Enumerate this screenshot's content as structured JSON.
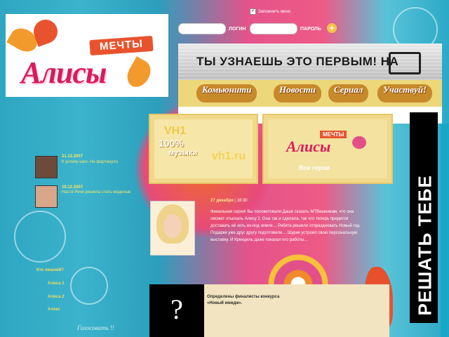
{
  "logo": {
    "badge": "МЕЧТЫ",
    "title": "Алисы"
  },
  "login": {
    "remember_label": "Запомнить меня",
    "login_label": "ЛОГИН",
    "password_label": "ПАРОЛЬ",
    "submit_symbol": "+"
  },
  "banner": {
    "text": "ТЫ УЗНАЕШЬ ЭТО ПЕРВЫМ!  НА"
  },
  "nav": {
    "items": [
      {
        "label": "Комьюнити"
      },
      {
        "label": "Новости"
      },
      {
        "label": "Сериал"
      },
      {
        "label": "Участвуй!"
      }
    ]
  },
  "promos": [
    {
      "line1": "VH1",
      "line2": "100%",
      "line3": "музыки",
      "logo": "vh1.ru"
    },
    {
      "badge": "МЕЧТЫ",
      "title": "Алисы",
      "caption": "Все герои"
    }
  ],
  "side_banner": {
    "text": "РЕШАТЬ ТЕБЕ"
  },
  "news": [
    {
      "date": "21.12.2007",
      "text": "К успеху шел. Не фартануло"
    },
    {
      "date": "19.12.2007",
      "text": "Настя Речи решила стать моделью"
    }
  ],
  "poll": {
    "question": "Кто лишний?",
    "options": [
      "Алиса 1",
      "Алиса 2",
      "Алекс"
    ]
  },
  "article": {
    "date": "27 декабря",
    "time": "18:30",
    "body": "Финальная серия! Вы посоветовали Даше сказать МТВишникам, что она сможет отыскать Алису 2. Она так и сделала, так что теперь придется доставать её хоть из-под земли… Ребята решили отпраздновать Новый год. Подарки уже друг другу подготовили… Шурик устроил свою персональную выставку. И Крендель даже показал его работы…"
  },
  "bottom": {
    "question_mark": "?",
    "contest": "Определены финалисты конкурса «Новый имидж».",
    "vote_link": "Голосовать !!"
  },
  "colors": {
    "brand_pink": "#d91b5c",
    "nav_gold": "#c7892a",
    "news_yellow": "#f5e66a"
  }
}
